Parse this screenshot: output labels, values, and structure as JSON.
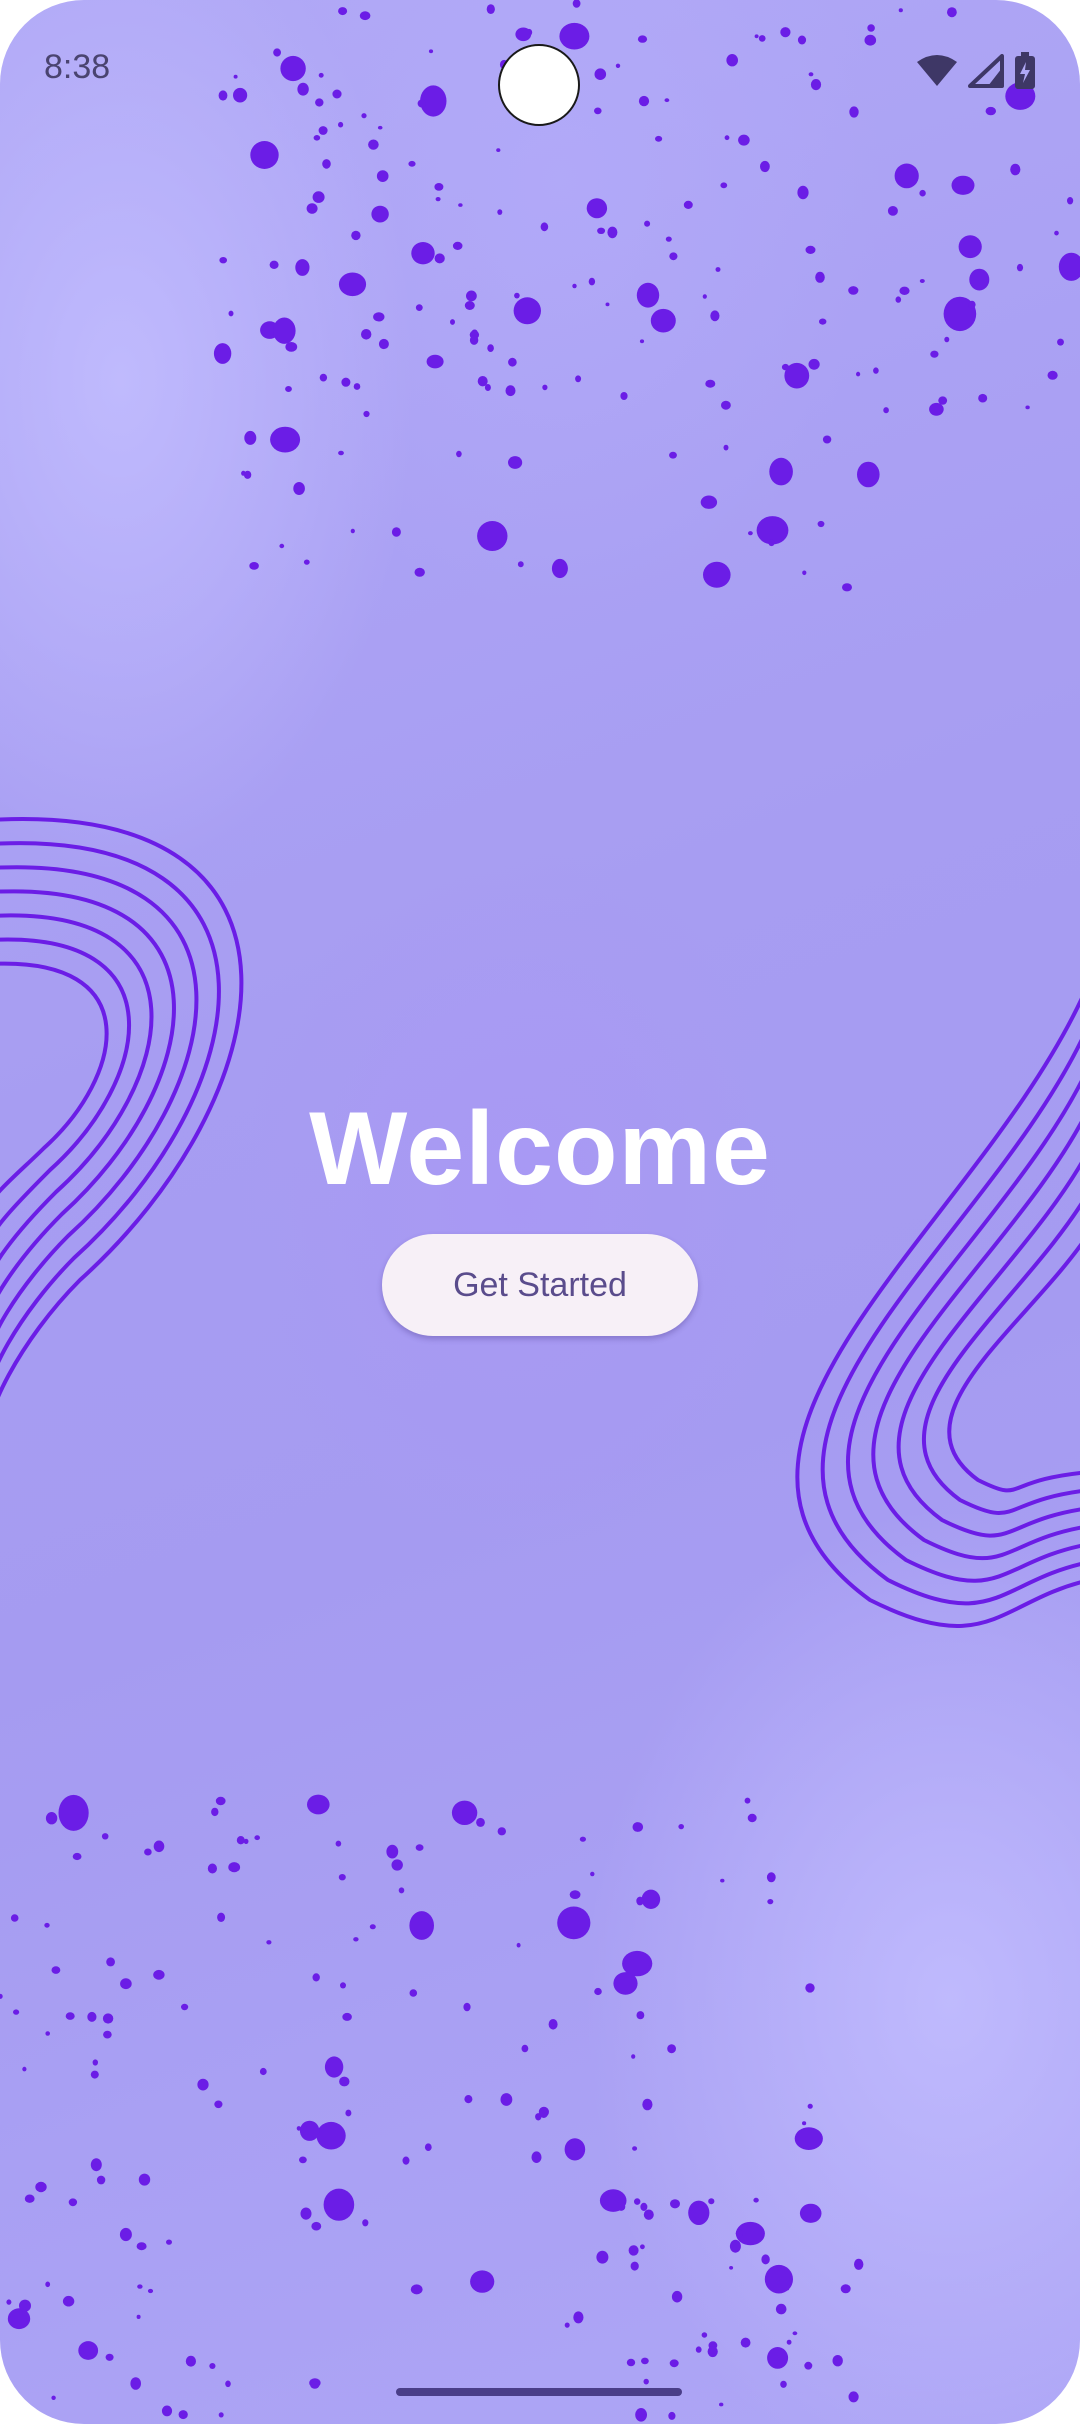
{
  "status_bar": {
    "time": "8:38",
    "icons": [
      "wifi-icon",
      "signal-icon",
      "battery-icon"
    ]
  },
  "main": {
    "title": "Welcome",
    "button_label": "Get Started"
  },
  "colors": {
    "background": "#a79df2",
    "splatter": "#6b1de6",
    "title": "#ffffff",
    "button_bg": "#f7f0f7",
    "button_text": "#5a4c8c"
  }
}
